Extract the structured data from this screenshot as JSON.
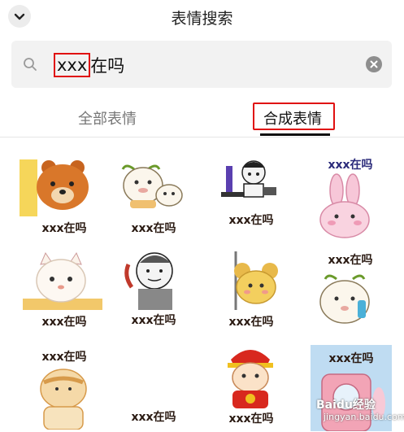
{
  "header": {
    "title": "表情搜索"
  },
  "search": {
    "query_highlight": "xxx",
    "query_rest": "在吗"
  },
  "tabs": [
    {
      "label": "全部表情"
    },
    {
      "label": "合成表情"
    }
  ],
  "stickers": [
    {
      "caption": "xxx在吗",
      "subject": "brown bear peeking"
    },
    {
      "caption": "xxx在吗",
      "subject": "round face with cat"
    },
    {
      "caption": "xxx在吗",
      "subject": "meme boy at computer"
    },
    {
      "caption": "xxx在吗",
      "subject": "pink bunny"
    },
    {
      "caption": "xxx在吗",
      "subject": "white cat"
    },
    {
      "caption": "xxx在吗",
      "subject": "meme guy on phone"
    },
    {
      "caption": "xxx在吗",
      "subject": "yellow mouse peeking"
    },
    {
      "caption": "xxx在吗",
      "subject": "round face on phone"
    },
    {
      "caption": "xxx在吗",
      "subject": "orange dog"
    },
    {
      "caption": "xxx在吗",
      "subject": "blank"
    },
    {
      "caption": "xxx在吗",
      "subject": "god of wealth"
    },
    {
      "caption": "xxx在吗",
      "subject": "bunny in phone booth"
    }
  ],
  "watermark": {
    "line1": "Baidu经验",
    "line2": "jingyan.baidu.com"
  }
}
